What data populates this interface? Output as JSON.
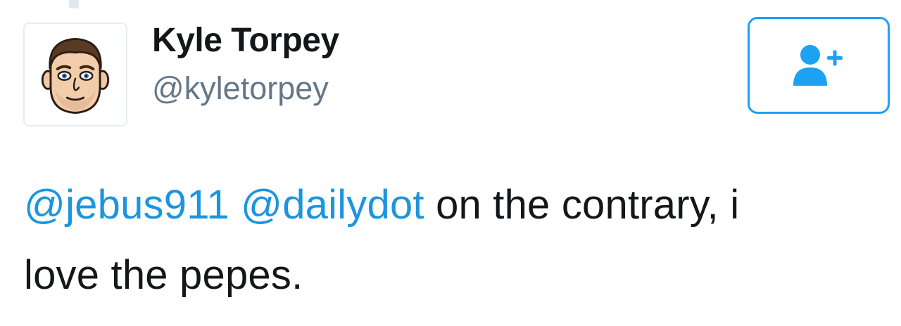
{
  "tweet": {
    "display_name": "Kyle Torpey",
    "handle": "@kyletorpey",
    "mentions": [
      "@jebus911",
      "@dailydot"
    ],
    "body_line1": "on the contrary, i",
    "body_line2": "love the pepes."
  },
  "avatar": {
    "icon": "bitmoji-avatar"
  },
  "follow_button": {
    "icon": "add-user-icon"
  },
  "colors": {
    "accent": "#1da1f2",
    "mention": "#1b95e0",
    "text": "#14171a",
    "secondary_text": "#657786"
  }
}
